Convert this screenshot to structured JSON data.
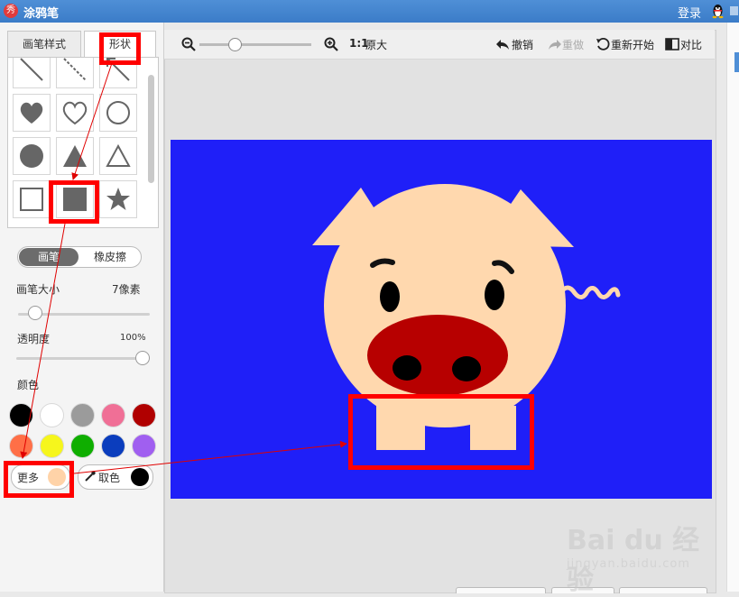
{
  "app": {
    "title": "涂鸦笔",
    "login": "登录"
  },
  "tabs": {
    "brush_style": "画笔样式",
    "shape": "形状"
  },
  "mode": {
    "pen": "画笔",
    "eraser": "橡皮擦"
  },
  "brush_size": {
    "label": "画笔大小",
    "value": "7像素",
    "level": 0.08
  },
  "opacity": {
    "label": "透明度",
    "value": "100%",
    "level": 1.0
  },
  "color": {
    "label": "颜色",
    "swatches": [
      "#000000",
      "#ffffff",
      "#9b9b9b",
      "#f06f96",
      "#b00000",
      "#ff6f47",
      "#f6f61c",
      "#0fae00",
      "#0b3dbd",
      "#a05ff0"
    ],
    "more_label": "更多",
    "more_color": "#ffd3a8",
    "pick_label": "取色",
    "pick_color": "#000000"
  },
  "toolbar": {
    "zoom_label": "1:1",
    "original_label": "原大",
    "undo": "撤销",
    "redo": "重做",
    "restart": "重新开始",
    "compare": "对比"
  },
  "canvas": {
    "background": "#1f1ff8"
  },
  "shapes": [
    "line-solid",
    "line-dashed",
    "line-arrow",
    "heart-filled",
    "heart-outline",
    "circle-outline",
    "circle-filled",
    "triangle-filled",
    "triangle-outline",
    "square-outline",
    "square-filled",
    "star-filled"
  ],
  "watermark": {
    "logo": "Bai du 经验",
    "url": "jingyan.baidu.com"
  }
}
